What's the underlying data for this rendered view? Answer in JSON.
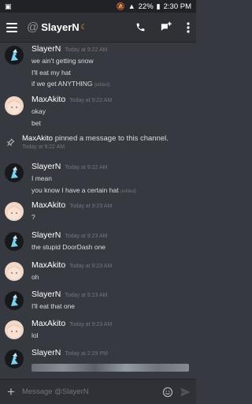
{
  "statusbar": {
    "battery": "22%",
    "time": "2:30 PM"
  },
  "header": {
    "title": "SlayerN"
  },
  "messages": [
    {
      "author": "SlayerN",
      "timestamp": "Today at 9:22 AM",
      "lines": [
        "we ain't getting snow",
        "I'll eat my hat",
        "if we get ANYTHING"
      ],
      "edited_line": 2
    },
    {
      "author": "MaxAkito",
      "timestamp": "Today at 9:22 AM",
      "lines": [
        "okay",
        "bet"
      ]
    },
    {
      "author": "SlayerN",
      "timestamp": "Today at 9:22 AM",
      "lines": [
        "I mean",
        "you know I have a certain hat"
      ],
      "edited_line": 1
    },
    {
      "author": "MaxAkito",
      "timestamp": "Today at 9:23 AM",
      "lines": [
        "?"
      ]
    },
    {
      "author": "SlayerN",
      "timestamp": "Today at 9:23 AM",
      "lines": [
        "the stupid DoorDash one"
      ]
    },
    {
      "author": "MaxAkito",
      "timestamp": "Today at 9:23 AM",
      "lines": [
        "oh"
      ]
    },
    {
      "author": "SlayerN",
      "timestamp": "Today at 9:23 AM",
      "lines": [
        "I'll eat that one"
      ]
    },
    {
      "author": "MaxAkito",
      "timestamp": "Today at 9:23 AM",
      "lines": [
        "lol"
      ]
    },
    {
      "author": "SlayerN",
      "timestamp": "Today at 2:29 PM",
      "lines": []
    }
  ],
  "edited_label": "(edited)",
  "pin_notice": {
    "who": "MaxAkito",
    "text": "pinned a message to this channel.",
    "timestamp": "Today at 9:22 AM"
  },
  "input": {
    "placeholder": "Message @SlayerN",
    "value": ""
  },
  "icons": [
    "menu-icon",
    "phone-icon",
    "new-group-dm-icon",
    "more-vert-icon",
    "pin-icon",
    "plus-icon",
    "emoji-icon",
    "send-icon"
  ],
  "colors": {
    "background": "#36393f",
    "header": "#2f3136",
    "timestamp": "#72767d",
    "idle": "#faa61a"
  }
}
